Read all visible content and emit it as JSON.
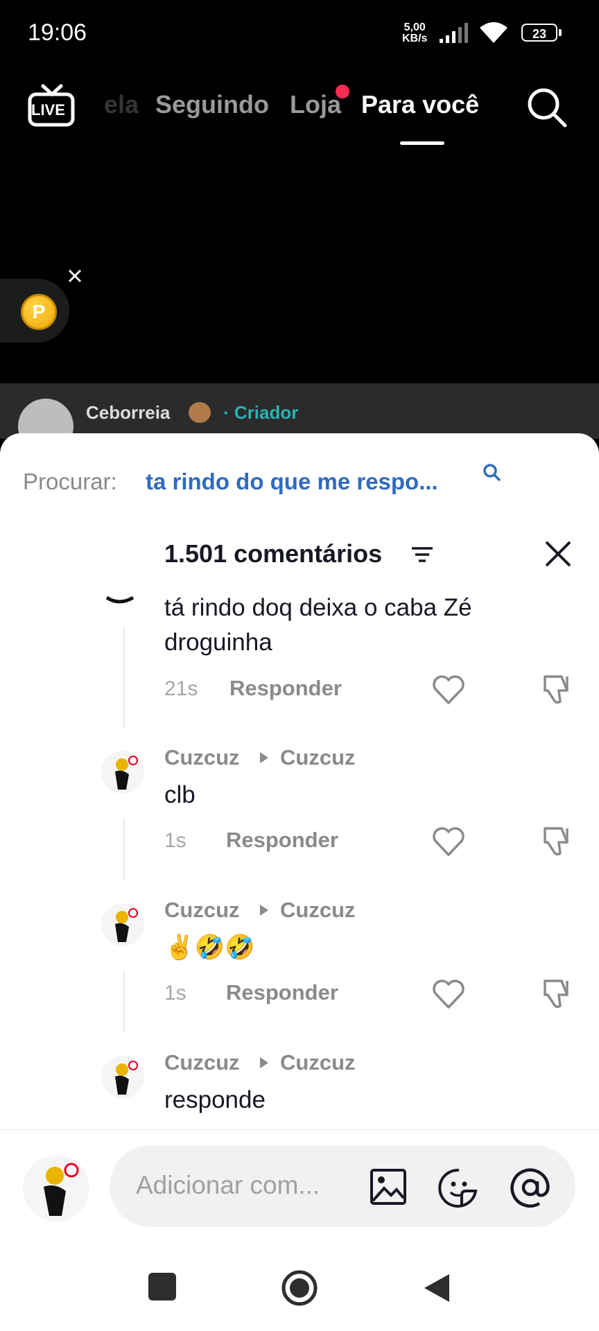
{
  "status_bar": {
    "time": "19:06",
    "net_speed_value": "5,00",
    "net_speed_unit": "KB/s",
    "battery": "23"
  },
  "top_nav": {
    "live_label": "LIVE",
    "tabs": [
      {
        "label": "ela",
        "active": false
      },
      {
        "label": "Seguindo",
        "active": false
      },
      {
        "label": "Loja",
        "active": false,
        "has_dot": true
      },
      {
        "label": "Para você",
        "active": true
      }
    ],
    "search_icon": "search-icon"
  },
  "coin_widget": {
    "icon": "coin-icon",
    "letter": "P"
  },
  "creator": {
    "name": "Ceborreia",
    "tag": "· Criador"
  },
  "comments_sheet": {
    "search_prefix": "Procurar:",
    "search_term": "ta rindo do que me respo...",
    "title": "1.501 comentários",
    "comments": [
      {
        "author": "",
        "reply_to": "",
        "text": "tá rindo doq deixa o caba Zé droguinha",
        "time": "21s",
        "reply_label": "Responder"
      },
      {
        "author": "Cuzcuz",
        "reply_to": "Cuzcuz",
        "text": "clb",
        "time": "1s",
        "reply_label": "Responder"
      },
      {
        "author": "Cuzcuz",
        "reply_to": "Cuzcuz",
        "text": "✌️🤣🤣",
        "time": "1s",
        "reply_label": "Responder"
      },
      {
        "author": "Cuzcuz",
        "reply_to": "Cuzcuz",
        "text": "responde",
        "time": "",
        "reply_label": ""
      }
    ],
    "input_placeholder": "Adicionar com..."
  },
  "colors": {
    "accent_red": "#fe2c55",
    "link_blue": "#2f6bbf",
    "creator_teal": "#2bb3b1"
  }
}
